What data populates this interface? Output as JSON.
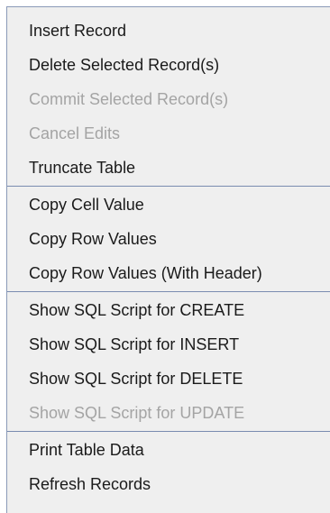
{
  "menu": {
    "groups": [
      {
        "items": [
          {
            "label": "Insert Record",
            "enabled": true
          },
          {
            "label": "Delete Selected Record(s)",
            "enabled": true
          },
          {
            "label": "Commit Selected Record(s)",
            "enabled": false
          },
          {
            "label": "Cancel Edits",
            "enabled": false
          },
          {
            "label": "Truncate Table",
            "enabled": true
          }
        ]
      },
      {
        "items": [
          {
            "label": "Copy Cell Value",
            "enabled": true
          },
          {
            "label": "Copy Row Values",
            "enabled": true
          },
          {
            "label": "Copy Row Values (With Header)",
            "enabled": true
          }
        ]
      },
      {
        "items": [
          {
            "label": "Show SQL Script for CREATE",
            "enabled": true
          },
          {
            "label": "Show SQL Script for INSERT",
            "enabled": true
          },
          {
            "label": "Show SQL Script for DELETE",
            "enabled": true
          },
          {
            "label": "Show SQL Script for UPDATE",
            "enabled": false
          }
        ]
      },
      {
        "items": [
          {
            "label": "Print Table Data",
            "enabled": true
          },
          {
            "label": "Refresh Records",
            "enabled": true
          }
        ]
      }
    ]
  }
}
